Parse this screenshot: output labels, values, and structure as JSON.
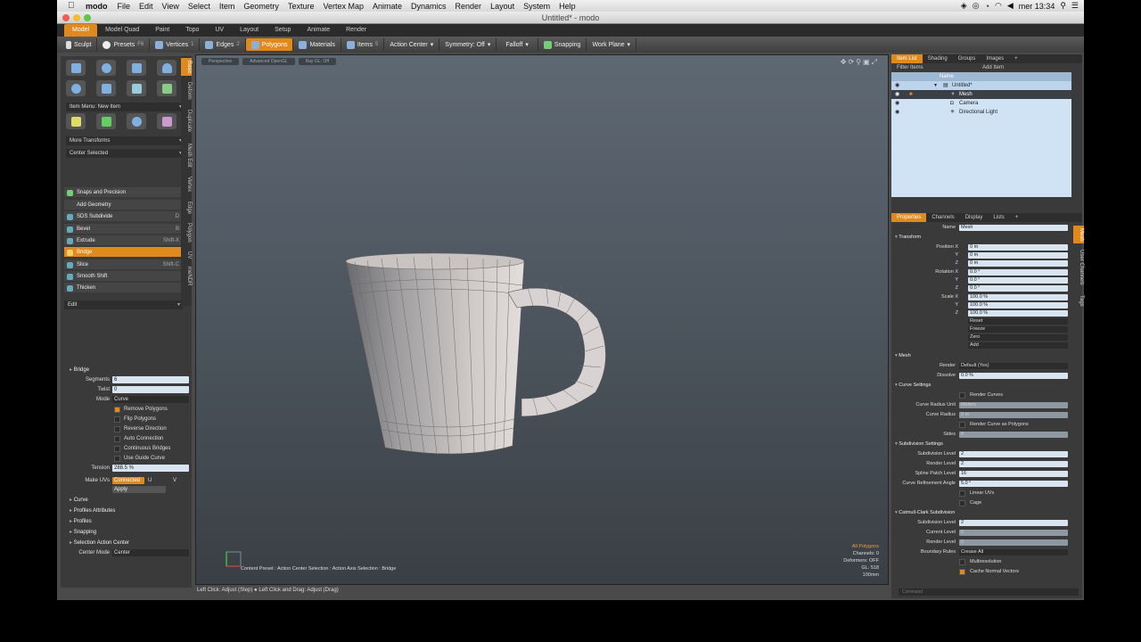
{
  "menubar": {
    "apple": "",
    "app": "modo",
    "items": [
      "File",
      "Edit",
      "View",
      "Select",
      "Item",
      "Geometry",
      "Texture",
      "Vertex Map",
      "Animate",
      "Dynamics",
      "Render",
      "Layout",
      "System",
      "Help"
    ],
    "clock": "mer 13:34"
  },
  "window": {
    "title": "Untitled* - modo"
  },
  "tabs": [
    "Model",
    "Model Quad",
    "Paint",
    "Topo",
    "UV",
    "Layout",
    "Setup",
    "Animate",
    "Render"
  ],
  "toolbar": {
    "sculpt": "Sculpt",
    "presets": "Presets",
    "presets_key": "F6",
    "vertices": "Vertices",
    "vertices_key": "1",
    "edges": "Edges",
    "edges_key": "2",
    "polygons": "Polygons",
    "materials": "Materials",
    "items": "Items",
    "items_key": "5",
    "action_center": "Action Center",
    "symmetry": "Symmetry: Off",
    "falloff": "Falloff",
    "snapping": "Snapping",
    "work_plane": "Work Plane"
  },
  "left": {
    "vtabs": [
      "Basic",
      "Deform",
      "Duplicate",
      "Mesh Edit",
      "Vertex",
      "Edge",
      "Polygon",
      "UV",
      "meNDR"
    ],
    "item_menu": "Item Menu: New Item",
    "more_transforms": "More Transforms",
    "center_selected": "Center Selected",
    "snaps": "Snaps and Precision",
    "add_geometry": "Add Geometry",
    "items": [
      {
        "label": "SDS Subdivide",
        "key": "D"
      },
      {
        "label": "Bevel",
        "key": "B"
      },
      {
        "label": "Extrude",
        "key": "Shift-X"
      },
      {
        "label": "Bridge",
        "key": ""
      },
      {
        "label": "Slice",
        "key": "Shift-C"
      },
      {
        "label": "Smooth Shift",
        "key": ""
      },
      {
        "label": "Thicken",
        "key": ""
      }
    ],
    "edit": "Edit"
  },
  "bridge": {
    "title": "Bridge",
    "segments_label": "Segments",
    "segments": "6",
    "twist_label": "Twist",
    "twist": "0",
    "mode_label": "Mode",
    "mode": "Curve",
    "remove_polygons": "Remove Polygons",
    "flip_polygons": "Flip Polygons",
    "reverse_direction": "Reverse Direction",
    "auto_connection": "Auto Connection",
    "continuous_bridges": "Continuous Bridges",
    "use_guide_curve": "Use Guide Curve",
    "tension_label": "Tension",
    "tension": "288.5 %",
    "make_uvs_label": "Make UVs",
    "make_uvs": "Connected",
    "u": "U",
    "v": "V",
    "apply": "Apply",
    "sections": [
      "Curve",
      "Profiles Attributes",
      "Profiles",
      "Snapping",
      "Selection Action Center"
    ],
    "center_mode_label": "Center Mode",
    "center_mode": "Center"
  },
  "viewport": {
    "tabs": [
      "Perspective",
      "Advanced OpenGL",
      "Ray GL: Off"
    ],
    "stats": {
      "polys": "All Polygons",
      "channels": "Channels: 0",
      "deformers": "Deformers: OFF",
      "gl": "GL: 518",
      "scale": "100mm"
    },
    "preset": "Content Preset : Action Center Selection : Action Axis Selection : Bridge"
  },
  "status": "Left Click: Adjust (Step) ● Left Click and Drag: Adjust (Drag)",
  "right": {
    "top_tabs": [
      "Item List",
      "Shading",
      "Groups",
      "Images",
      "+"
    ],
    "filter": "Filter Items",
    "add_item": "Add Item",
    "col_name": "Name",
    "tree": [
      "Untitled*",
      "Mesh",
      "Camera",
      "Directional Light"
    ],
    "prop_tabs": [
      "Properties",
      "Channels",
      "Display",
      "Lists",
      "+"
    ],
    "name_label": "Name",
    "name": "Mesh",
    "transform": "Transform",
    "position_label": "Position",
    "position": [
      "0 m",
      "0 m",
      "0 m"
    ],
    "rotation_label": "Rotation",
    "rotation": [
      "0.0 °",
      "0.0 °",
      "0.0 °"
    ],
    "scale_label": "Scale",
    "scale": [
      "100.0 %",
      "100.0 %",
      "100.0 %"
    ],
    "axes": [
      "X",
      "Y",
      "Z"
    ],
    "reset": "Reset",
    "freeze": "Freeze",
    "zero": "Zero",
    "add": "Add",
    "mesh": "Mesh",
    "render_label": "Render",
    "render": "Default (Yes)",
    "dissolve_label": "Dissolve",
    "dissolve": "0.0 %",
    "curve_settings": "Curve Settings",
    "render_curves": "Render Curves",
    "curve_radius_unit_label": "Curve Radius Unit",
    "curve_radius_unit": "Meters",
    "curve_radius_label": "Curve Radius",
    "curve_radius": "0 m",
    "render_curve_polys": "Render Curve as Polygons",
    "sides_label": "Sides",
    "sides": "8",
    "subdivision_settings": "Subdivision Settings",
    "subdiv_level_label": "Subdivision Level",
    "subdiv_level": "2",
    "render_level_label": "Render Level",
    "render_level": "2",
    "spline_patch_label": "Spline Patch Level",
    "spline_patch": "16",
    "curve_refine_label": "Curve Refinement Angle",
    "curve_refine": "5.0 °",
    "linear_uvs": "Linear UVs",
    "cage": "Cage",
    "catmull": "Catmull-Clark Subdivision",
    "cc_subdiv_label": "Subdivision Level",
    "cc_subdiv": "2",
    "current_level_label": "Current Level",
    "current_level": "0",
    "cc_render_label": "Render Level",
    "cc_render": "0",
    "boundary_label": "Boundary Rules",
    "boundary": "Crease All",
    "multires": "Multiresolution",
    "cache_normals": "Cache Normal Vectors",
    "vtabs": [
      "Mesh",
      "User Channels",
      "Tags"
    ]
  },
  "command": "Command"
}
